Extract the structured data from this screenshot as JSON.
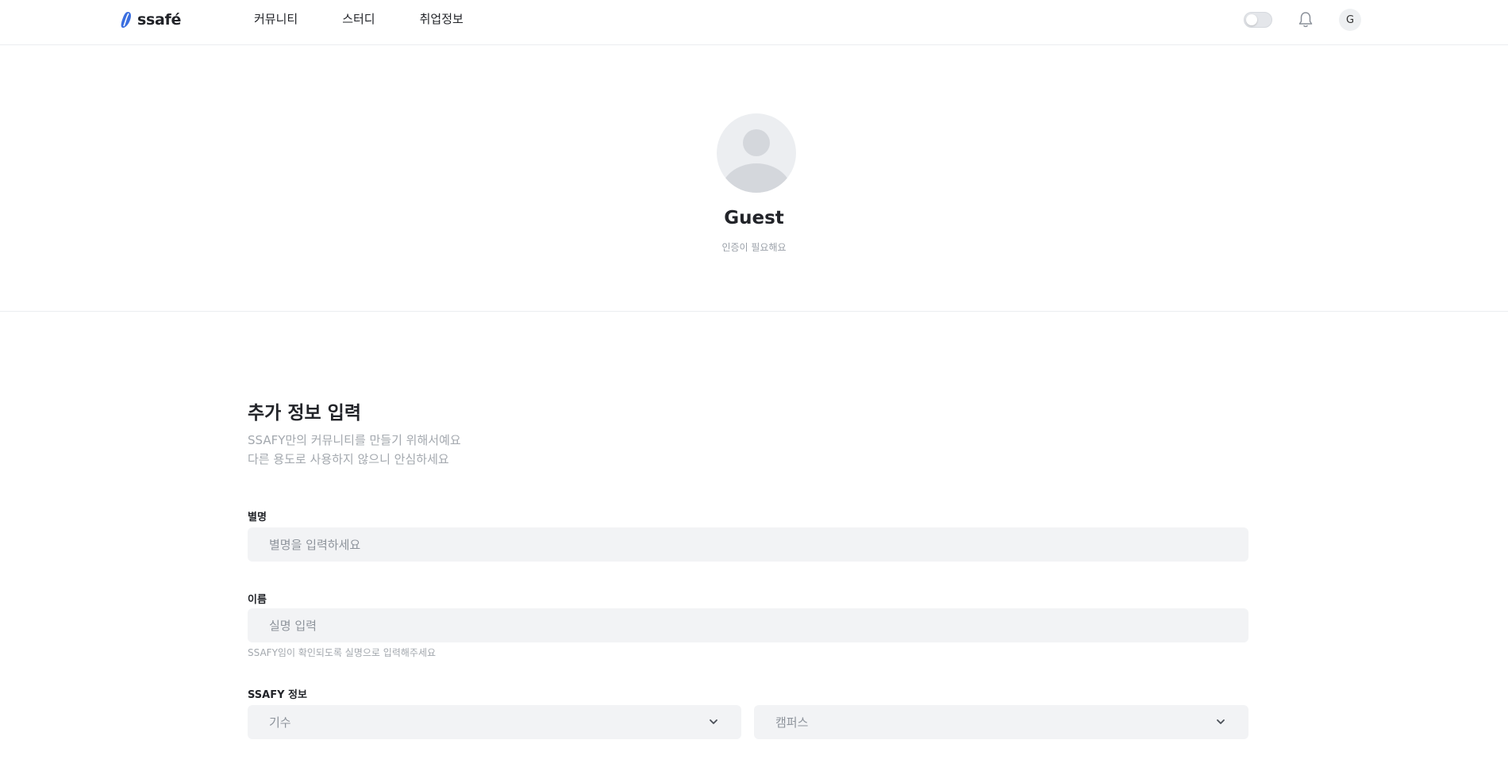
{
  "header": {
    "logo_text": "ssafé",
    "nav": [
      "커뮤니티",
      "스터디",
      "취업정보"
    ],
    "avatar_initial": "G",
    "accent": "#3b6fe0"
  },
  "profile": {
    "name": "Guest",
    "subtitle": "인증이 필요해요"
  },
  "form": {
    "title": "추가 정보 입력",
    "desc_line1": "SSAFY만의 커뮤니티를 만들기 위해서예요",
    "desc_line2": "다른 용도로 사용하지 않으니 안심하세요",
    "nickname_label": "별명",
    "nickname_placeholder": "별명을 입력하세요",
    "name_label": "이름",
    "name_placeholder": "실명 입력",
    "name_help": "SSAFY임이 확인되도록 실명으로 입력해주세요",
    "ssafy_label": "SSAFY 정보",
    "generation_placeholder": "기수",
    "campus_placeholder": "캠퍼스"
  }
}
